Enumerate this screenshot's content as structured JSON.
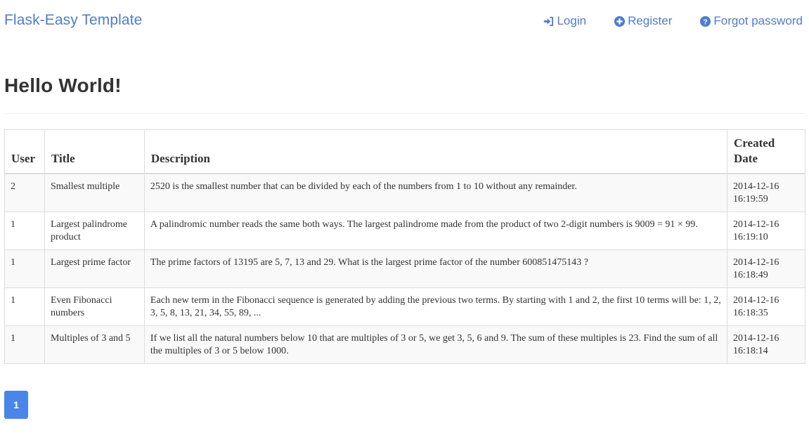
{
  "navbar": {
    "brand": "Flask-Easy Template",
    "links": [
      {
        "label": "Login",
        "icon": "sign-in-icon"
      },
      {
        "label": "Register",
        "icon": "plus-circle-icon"
      },
      {
        "label": "Forgot password",
        "icon": "question-circle-icon"
      }
    ]
  },
  "main": {
    "title": "Hello World!",
    "table": {
      "headers": [
        "User",
        "Title",
        "Description",
        "Created Date"
      ],
      "rows": [
        {
          "user": "2",
          "title": "Smallest multiple",
          "description": "2520 is the smallest number that can be divided by each of the numbers from 1 to 10 without any remainder.",
          "date": "2014-12-16",
          "time": "16:19:59"
        },
        {
          "user": "1",
          "title": "Largest palindrome product",
          "description": "A palindromic number reads the same both ways. The largest palindrome made from the product of two 2-digit numbers is 9009 = 91 × 99.",
          "date": "2014-12-16",
          "time": "16:19:10"
        },
        {
          "user": "1",
          "title": "Largest prime factor",
          "description": "The prime factors of 13195 are 5, 7, 13 and 29. What is the largest prime factor of the number 600851475143 ?",
          "date": "2014-12-16",
          "time": "16:18:49"
        },
        {
          "user": "1",
          "title": "Even Fibonacci numbers",
          "description": "Each new term in the Fibonacci sequence is generated by adding the previous two terms. By starting with 1 and 2, the first 10 terms will be: 1, 2, 3, 5, 8, 13, 21, 34, 55, 89, ...",
          "date": "2014-12-16",
          "time": "16:18:35"
        },
        {
          "user": "1",
          "title": "Multiples of 3 and 5",
          "description": "If we list all the natural numbers below 10 that are multiples of 3 or 5, we get 3, 5, 6 and 9. The sum of these multiples is 23. Find the sum of all the multiples of 3 or 5 below 1000.",
          "date": "2014-12-16",
          "time": "16:18:14"
        }
      ]
    },
    "pagination": {
      "current": "1"
    }
  },
  "colors": {
    "link": "#4f7ccf",
    "active_page": "#4a85e8",
    "border": "#dddddd",
    "stripe": "#f9f9f9"
  }
}
